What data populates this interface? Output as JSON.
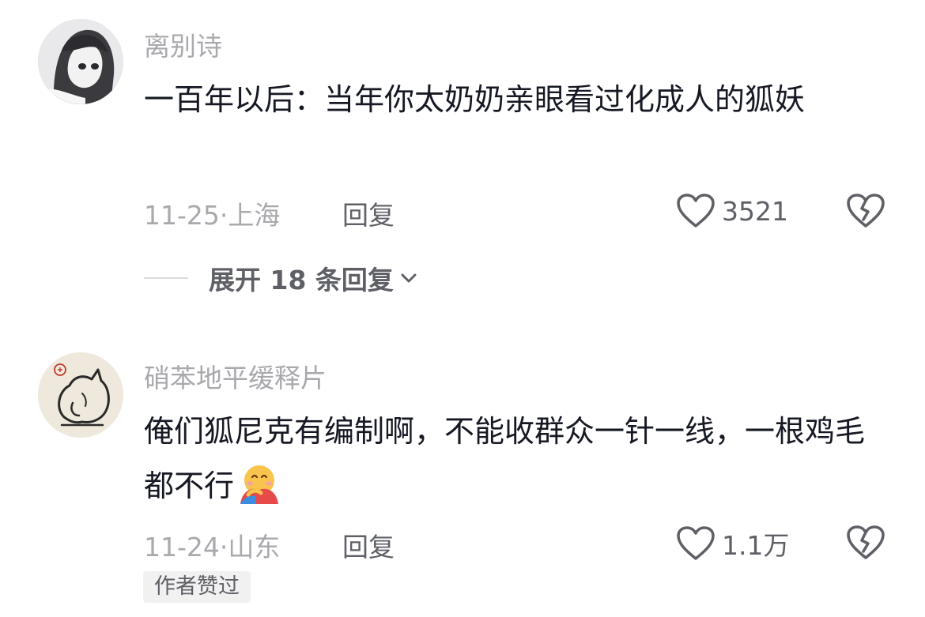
{
  "comments": [
    {
      "username": "离别诗",
      "avatar_icon": "anime-girl-avatar",
      "text": "一百年以后：当年你太奶奶亲眼看过化成人的狐妖",
      "date": "11-25",
      "separator": "·",
      "location": "上海",
      "reply_label": "回复",
      "like_count": "3521",
      "expand_label": "展开 18 条回复"
    },
    {
      "username": "硝苯地平缓释片",
      "avatar_icon": "fox-sketch-avatar",
      "text": "俺们狐尼克有编制啊，不能收群众一针一线，一根鸡毛都不行",
      "emoji_icon": "hugging-face-emoji",
      "date": "11-24",
      "separator": "·",
      "location": "山东",
      "reply_label": "回复",
      "like_count": "1.1万",
      "badge": "作者赞过"
    }
  ],
  "colors": {
    "primary_text": "#161823",
    "secondary_text": "#a8a9ad",
    "action_text": "#5e6066",
    "badge_bg": "#f1f1f2"
  }
}
